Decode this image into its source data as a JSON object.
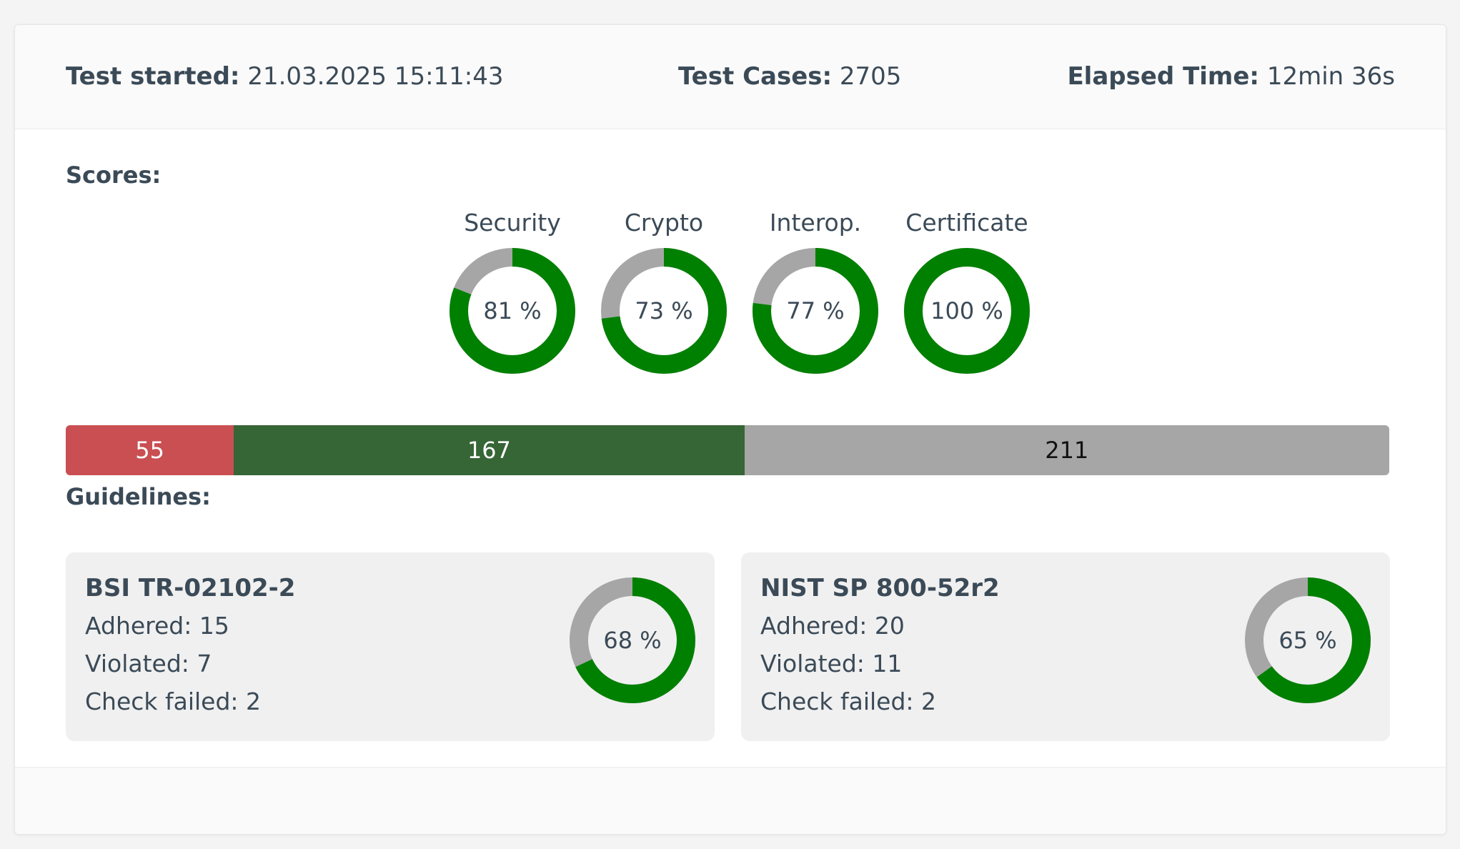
{
  "header": {
    "started_label": "Test started:",
    "started_value": "21.03.2025 15:11:43",
    "cases_label": "Test Cases:",
    "cases_value": "2705",
    "elapsed_label": "Elapsed Time:",
    "elapsed_value": "12min 36s"
  },
  "scores": {
    "title": "Scores:",
    "items": [
      {
        "label": "Security",
        "value": 81,
        "text": "81 %"
      },
      {
        "label": "Crypto",
        "value": 73,
        "text": "73 %"
      },
      {
        "label": "Interop.",
        "value": 77,
        "text": "77 %"
      },
      {
        "label": "Certificate",
        "value": 100,
        "text": "100 %"
      }
    ]
  },
  "summary_bar": {
    "segments": [
      {
        "value": 55,
        "label": "55",
        "color": "#c94f52",
        "text_color": "#ffffff"
      },
      {
        "value": 167,
        "label": "167",
        "color": "#366536",
        "text_color": "#ffffff"
      },
      {
        "value": 211,
        "label": "211",
        "color": "#a6a6a6",
        "text_color": "#111111"
      }
    ]
  },
  "guidelines": {
    "title": "Guidelines:",
    "items": [
      {
        "name": "BSI TR-02102-2",
        "adhered": "Adhered: 15",
        "violated": "Violated: 7",
        "check_failed": "Check failed: 2",
        "value": 68,
        "text": "68 %"
      },
      {
        "name": "NIST SP 800-52r2",
        "adhered": "Adhered: 20",
        "violated": "Violated: 11",
        "check_failed": "Check failed: 2",
        "value": 65,
        "text": "65 %"
      }
    ]
  },
  "colors": {
    "donut_fill": "#008000",
    "donut_track": "#a6a6a6"
  }
}
